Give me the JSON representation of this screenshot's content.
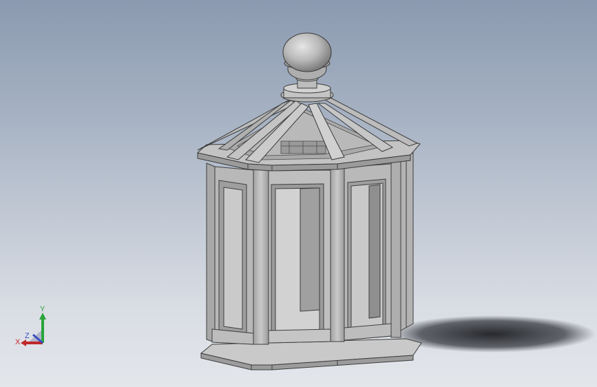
{
  "viewport": {
    "model": "octagonal-gazebo",
    "background_top": "#8b9ab0",
    "background_bottom": "#e3e6eb"
  },
  "triad": {
    "x_label": "X",
    "y_label": "Y",
    "z_label": "Z",
    "x_color": "#c0282b",
    "y_color": "#2aa53a",
    "z_color": "#3a4cc0"
  }
}
